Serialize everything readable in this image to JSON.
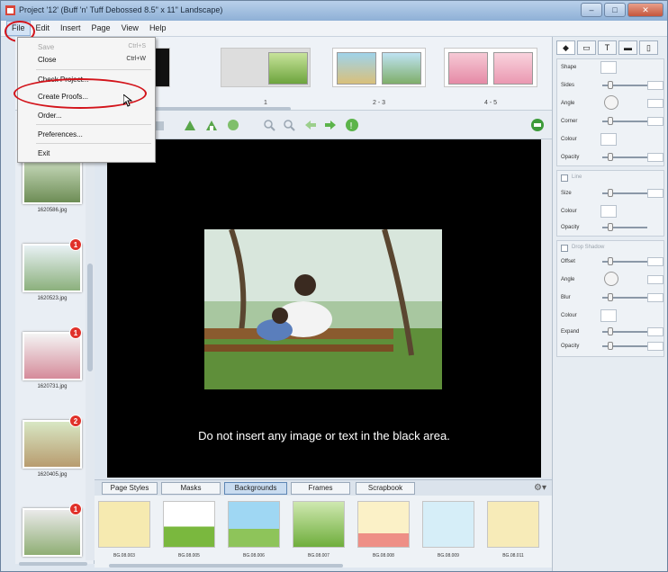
{
  "window": {
    "title": "Project '12' (Buff 'n' Tuff Debossed 8.5\" x 11\" Landscape)",
    "controls": [
      "–",
      "□",
      "✕"
    ]
  },
  "menubar": {
    "items": [
      "File",
      "Edit",
      "Insert",
      "Page",
      "View",
      "Help"
    ]
  },
  "file_menu": {
    "items": [
      {
        "label": "Save",
        "shortcut": "Ctrl+S",
        "disabled": true
      },
      {
        "label": "Close",
        "shortcut": "Ctrl+W",
        "disabled": false
      },
      {
        "label": "Check Project...",
        "shortcut": "",
        "disabled": false
      },
      {
        "label": "Create Proofs...",
        "shortcut": "",
        "disabled": false
      },
      {
        "label": "Order...",
        "shortcut": "",
        "disabled": false
      },
      {
        "label": "Preferences...",
        "shortcut": "",
        "disabled": false
      },
      {
        "label": "Exit",
        "shortcut": "",
        "disabled": false
      }
    ]
  },
  "page_strip": {
    "labels": [
      "1",
      "2 - 3",
      "4 - 5"
    ]
  },
  "left_photos": [
    {
      "name": "1620586.jpg",
      "badge": "1"
    },
    {
      "name": "1620523.jpg",
      "badge": "1"
    },
    {
      "name": "1620731.jpg",
      "badge": "1"
    },
    {
      "name": "1620405.jpg",
      "badge": "2"
    },
    {
      "name": "",
      "badge": "1"
    }
  ],
  "canvas": {
    "warning": "Do not insert any image or text in the black area."
  },
  "tabs": {
    "items": [
      "Page Styles",
      "Masks",
      "Backgrounds",
      "Frames",
      "Scrapbook"
    ],
    "active": "Backgrounds"
  },
  "backgrounds": {
    "labels": [
      "BG.08.003",
      "BG.08.005",
      "BG.08.006",
      "BG.08.007",
      "BG.08.008",
      "BG.08.009",
      "BG.08.011"
    ]
  },
  "properties": {
    "tabs": [
      "◆",
      "▭",
      "T",
      "▬",
      "▯"
    ],
    "shape_section": [
      "Shape",
      "Sides",
      "Angle",
      "Corner",
      "Colour",
      "Opacity"
    ],
    "line_section": {
      "toggle": "Line",
      "fields": [
        "Size",
        "Colour",
        "Opacity"
      ]
    },
    "shadow_section": {
      "toggle": "Drop Shadow",
      "fields": [
        "Offset",
        "Angle",
        "Blur",
        "Colour",
        "Expand",
        "Opacity"
      ]
    }
  },
  "colors": {
    "highlight": "#d3141b",
    "badge": "#e0312a",
    "canvas": "#000000"
  }
}
